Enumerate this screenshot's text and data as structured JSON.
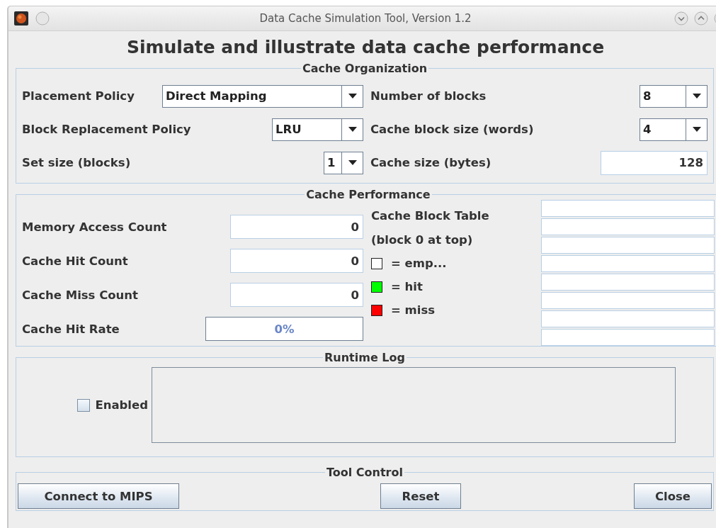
{
  "window": {
    "title": "Data Cache Simulation Tool, Version 1.2"
  },
  "heading": "Simulate and illustrate data cache performance",
  "cache_organization": {
    "title": "Cache Organization",
    "left_fields": [
      {
        "label": "Placement Policy",
        "kind": "dropdown",
        "value": "Direct Mapping"
      },
      {
        "label": "Block Replacement Policy",
        "kind": "dropdown",
        "value": "LRU"
      },
      {
        "label": "Set size (blocks)",
        "kind": "dropdown",
        "value": "1"
      }
    ],
    "right_fields": [
      {
        "label": "Number of blocks",
        "kind": "dropdown",
        "value": "8"
      },
      {
        "label": "Cache block size (words)",
        "kind": "dropdown",
        "value": "4"
      },
      {
        "label": "Cache size (bytes)",
        "kind": "text",
        "value": "128"
      }
    ]
  },
  "cache_performance": {
    "title": "Cache Performance",
    "counters": [
      {
        "label": "Memory Access Count",
        "kind": "count",
        "value": "0"
      },
      {
        "label": "Cache Hit Count",
        "kind": "count",
        "value": "0"
      },
      {
        "label": "Cache Miss Count",
        "kind": "count",
        "value": "0"
      },
      {
        "label": "Cache Hit Rate",
        "kind": "rate",
        "value": "0%"
      }
    ],
    "block_table": {
      "title": "Cache Block Table",
      "subtitle": "(block 0 at top)",
      "legend": [
        {
          "label": "= emp...",
          "color": "#ffffff"
        },
        {
          "label": "= hit",
          "color": "#00ff00"
        },
        {
          "label": "= miss",
          "color": "#ff0000"
        }
      ]
    }
  },
  "runtime_log": {
    "title": "Runtime Log",
    "enabled_label": "Enabled",
    "enabled": false
  },
  "tool_control": {
    "title": "Tool Control",
    "buttons": [
      "Connect to MIPS",
      "Reset",
      "Close"
    ]
  }
}
